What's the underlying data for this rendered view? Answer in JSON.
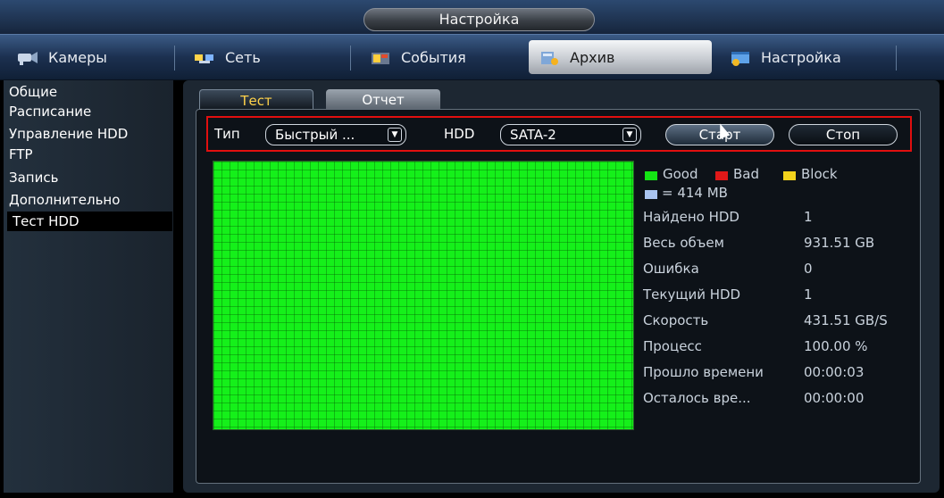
{
  "window": {
    "title": "Настройка"
  },
  "nav": {
    "tabs": [
      {
        "label": "Камеры",
        "icon": "camera-icon"
      },
      {
        "label": "Сеть",
        "icon": "network-icon"
      },
      {
        "label": "События",
        "icon": "events-icon"
      },
      {
        "label": "Архив",
        "icon": "archive-icon",
        "active": true
      },
      {
        "label": "Настройка",
        "icon": "settings-icon"
      }
    ]
  },
  "sidebar": {
    "items": [
      {
        "label": "Общие"
      },
      {
        "label": "Расписание"
      },
      {
        "label": "Управление HDD"
      },
      {
        "label": "FTP"
      },
      {
        "label": "Запись"
      },
      {
        "label": "Дополнительно"
      },
      {
        "label": "Тест HDD",
        "active": true
      }
    ]
  },
  "subtabs": [
    {
      "label": "Тест",
      "active": true
    },
    {
      "label": "Отчет"
    }
  ],
  "controls": {
    "type_label": "Тип",
    "type_value": "Быстрый ...",
    "hdd_label": "HDD",
    "hdd_value": "SATA-2",
    "start_label": "Старт",
    "stop_label": "Стоп"
  },
  "legend": {
    "good": "Good",
    "bad": "Bad",
    "block": "Block",
    "unit": "= 414 MB",
    "colors": {
      "good": "#14e414",
      "bad": "#e01818",
      "block": "#f2d21c",
      "unit": "#a9c4f0"
    }
  },
  "info": [
    {
      "key": "Найдено HDD",
      "value": "1"
    },
    {
      "key": "Весь объем",
      "value": "931.51 GB"
    },
    {
      "key": "Ошибка",
      "value": "0"
    },
    {
      "key": "Текущий HDD",
      "value": "1"
    },
    {
      "key": "Скорость",
      "value": "431.51 GB/S"
    },
    {
      "key": "Процесс",
      "value": "100.00 %"
    },
    {
      "key": "Прошло времени",
      "value": "00:00:03"
    },
    {
      "key": "Осталось вре...",
      "value": "00:00:00"
    }
  ],
  "colors": {
    "accent": "#ffd24a",
    "highlight": "#e10f0f",
    "map": "#15f01a"
  }
}
